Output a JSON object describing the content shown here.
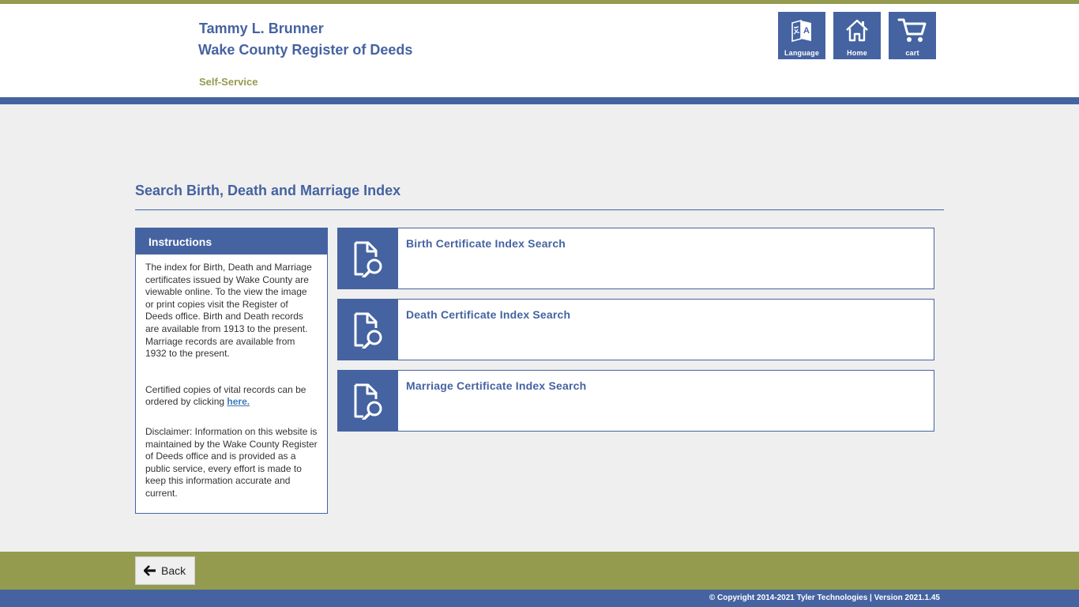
{
  "header": {
    "org_name": "Tammy L. Brunner",
    "org_sub": "Wake County Register of Deeds",
    "section": "Self-Service",
    "buttons": {
      "language": "Language",
      "home": "Home",
      "cart": "cart"
    }
  },
  "page": {
    "title": "Search Birth, Death and Marriage Index"
  },
  "instructions": {
    "heading": "Instructions",
    "p1": "The index for Birth, Death and Marriage certificates issued by Wake County are viewable online.  To the view the image or print copies visit the Register of Deeds office.  Birth and Death records are available from 1913 to the present. Marriage records are available from 1932 to the present.",
    "p2_text": "Certified copies of vital records can be ordered by clicking ",
    "p2_link": "here.",
    "p3": "Disclaimer:  Information on this website is maintained by the Wake County Register of Deeds office and is provided as a public service, every effort is made to keep this information accurate and current."
  },
  "searches": [
    {
      "label": "Birth Certificate Index Search",
      "icon": "document-search-icon"
    },
    {
      "label": "Death Certificate Index Search",
      "icon": "document-search-icon"
    },
    {
      "label": "Marriage Certificate Index Search",
      "icon": "document-search-icon"
    }
  ],
  "footer": {
    "back_label": "Back",
    "copyright": "© Copyright 2014-2021 Tyler Technologies | Version 2021.1.45"
  },
  "colors": {
    "primary": "#4563a1",
    "accent": "#949b4e",
    "background": "#efefef"
  }
}
